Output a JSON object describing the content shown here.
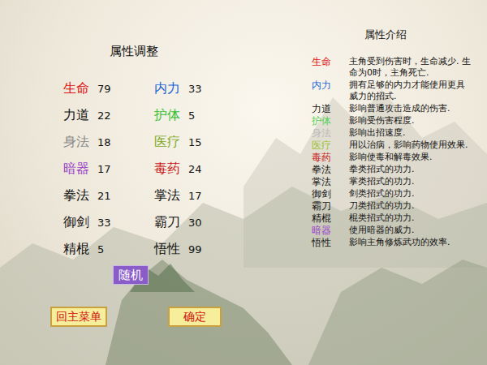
{
  "panel": {
    "title": "属性调整"
  },
  "attributes": [
    {
      "label": "生命",
      "value": "79",
      "color": "#e01010"
    },
    {
      "label": "内力",
      "value": "33",
      "color": "#1a64d8"
    },
    {
      "label": "力道",
      "value": "22",
      "color": "#111111"
    },
    {
      "label": "护体",
      "value": "5",
      "color": "#33c033"
    },
    {
      "label": "身法",
      "value": "18",
      "color": "#8a8a8a"
    },
    {
      "label": "医疗",
      "value": "15",
      "color": "#7fa81e"
    },
    {
      "label": "暗器",
      "value": "17",
      "color": "#9a3fc8"
    },
    {
      "label": "毒药",
      "value": "24",
      "color": "#c81818"
    },
    {
      "label": "拳法",
      "value": "21",
      "color": "#111111"
    },
    {
      "label": "掌法",
      "value": "17",
      "color": "#111111"
    },
    {
      "label": "御剑",
      "value": "33",
      "color": "#111111"
    },
    {
      "label": "霸刀",
      "value": "30",
      "color": "#111111"
    },
    {
      "label": "精棍",
      "value": "5",
      "color": "#111111"
    },
    {
      "label": "悟性",
      "value": "99",
      "color": "#111111"
    }
  ],
  "random_button": "随机",
  "buttons": [
    "回主菜单",
    "确定"
  ],
  "intro": {
    "title": "属性介绍",
    "items": [
      {
        "label": "生命",
        "text": "主角受到伤害时，生命减少. 生命为0时，主角死亡.",
        "color": "#e01010"
      },
      {
        "label": "内力",
        "text": "拥有足够的内力才能使用更具威力的招式.",
        "color": "#1a64d8"
      },
      {
        "label": "力道",
        "text": "影响普通攻击造成的伤害.",
        "color": "#111111"
      },
      {
        "label": "护体",
        "text": "影响受伤害程度.",
        "color": "#55d055"
      },
      {
        "label": "身法",
        "text": "影响出招速度.",
        "color": "#b8b8b8"
      },
      {
        "label": "医疗",
        "text": "用以治病，影响药物使用效果.",
        "color": "#9abe2a"
      },
      {
        "label": "毒药",
        "text": "影响使毒和解毒效果.",
        "color": "#c81818"
      },
      {
        "label": "拳法",
        "text": "拳类招式的功力.",
        "color": "#111111"
      },
      {
        "label": "掌法",
        "text": "掌类招式的功力.",
        "color": "#111111"
      },
      {
        "label": "御剑",
        "text": "剑类招式的功力.",
        "color": "#111111"
      },
      {
        "label": "霸刀",
        "text": "刀类招式的功力.",
        "color": "#111111"
      },
      {
        "label": "精棍",
        "text": "棍类招式的功力.",
        "color": "#111111"
      },
      {
        "label": "暗器",
        "text": "使用暗器的威力.",
        "color": "#9a3fc8"
      },
      {
        "label": "悟性",
        "text": "影响主角修炼武功的效率.",
        "color": "#111111"
      }
    ]
  }
}
